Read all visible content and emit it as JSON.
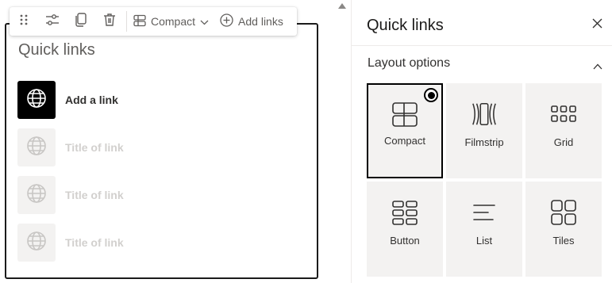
{
  "toolbar": {
    "drag_icon": "drag-handle-icon",
    "settings_icon": "sliders-icon",
    "duplicate_icon": "duplicate-icon",
    "delete_icon": "trash-icon",
    "layout_label": "Compact",
    "add_links_label": "Add links"
  },
  "webpart": {
    "title": "Quick links",
    "links": [
      {
        "label": "Add a link",
        "state": "active"
      },
      {
        "label": "Title of link",
        "state": "placeholder"
      },
      {
        "label": "Title of link",
        "state": "placeholder"
      },
      {
        "label": "Title of link",
        "state": "placeholder"
      }
    ]
  },
  "panel": {
    "title": "Quick links",
    "close_icon": "close-icon",
    "section": {
      "label": "Layout options",
      "expanded": true
    },
    "layouts": [
      {
        "label": "Compact",
        "icon": "compact-layout-icon",
        "selected": true
      },
      {
        "label": "Filmstrip",
        "icon": "filmstrip-layout-icon",
        "selected": false
      },
      {
        "label": "Grid",
        "icon": "grid-layout-icon",
        "selected": false
      },
      {
        "label": "Button",
        "icon": "button-layout-icon",
        "selected": false
      },
      {
        "label": "List",
        "icon": "list-layout-icon",
        "selected": false
      },
      {
        "label": "Tiles",
        "icon": "tiles-layout-icon",
        "selected": false
      }
    ]
  },
  "colors": {
    "accent": "#000000",
    "placeholder_text": "#d2d0ce",
    "tile_bg": "#f3f2f1"
  }
}
